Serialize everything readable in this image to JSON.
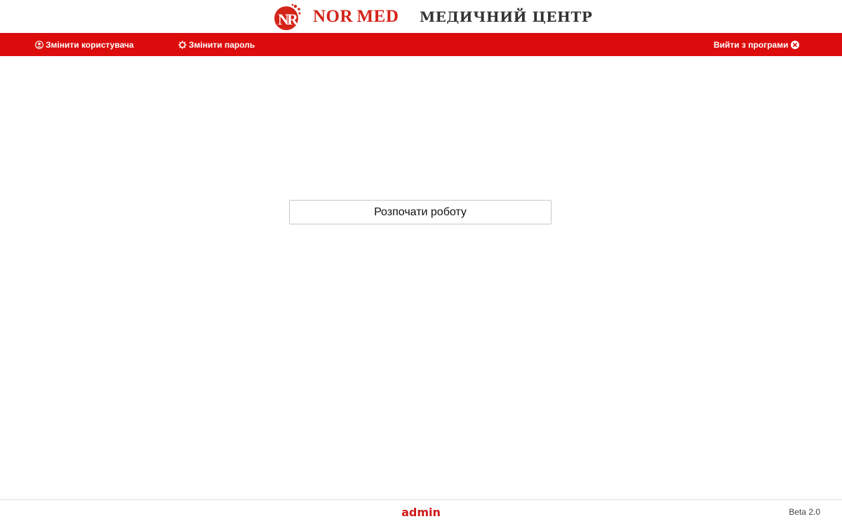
{
  "header": {
    "logo_text": "NOR MED",
    "center_title": "МЕДИЧНИЙ ЦЕНТР"
  },
  "navbar": {
    "change_user": {
      "label": "Змінити користувача",
      "icon": "user-circle-icon"
    },
    "change_password": {
      "label": "Змінити пароль",
      "icon": "gear-icon"
    },
    "exit": {
      "label": "Вийти з програми",
      "icon": "close-circle-icon"
    }
  },
  "main": {
    "start_button_label": "Розпочати роботу"
  },
  "footer": {
    "username": "admin",
    "version": "Beta 2.0"
  },
  "colors": {
    "brand_red": "#dc0c0c",
    "logo_red": "#d4241a",
    "username_red": "#d01818"
  }
}
